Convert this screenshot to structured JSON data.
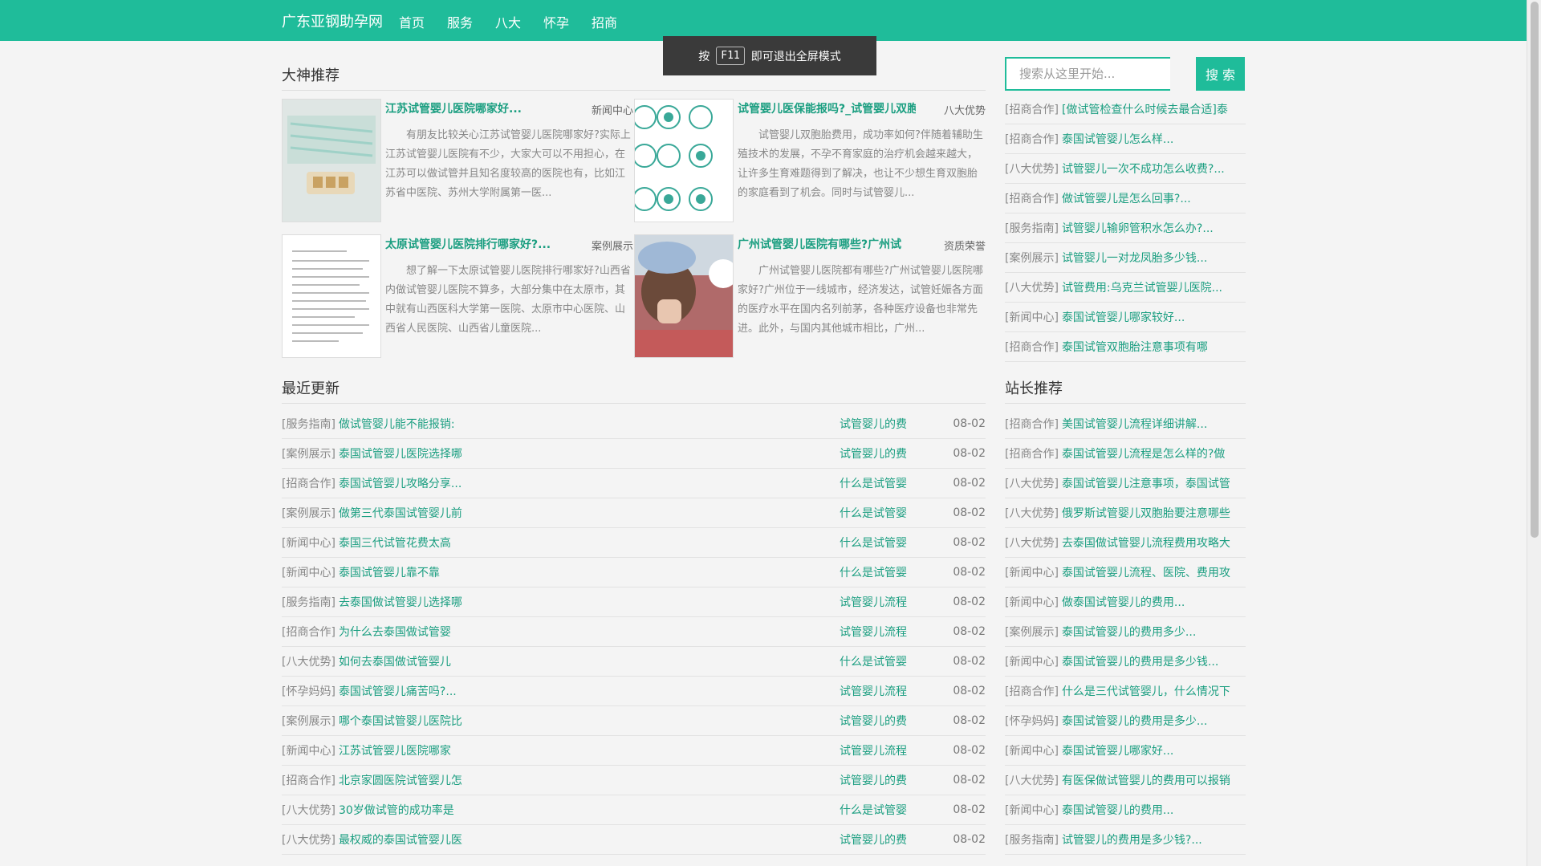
{
  "nav": {
    "brand": "广东亚钢助孕网",
    "items": [
      "首页",
      "服务",
      "八大",
      "怀孕",
      "招商"
    ]
  },
  "toast": {
    "before": "按",
    "key": "F11",
    "after": "即可退出全屏模式"
  },
  "search": {
    "placeholder": "搜索从这里开始...",
    "button": "搜 索"
  },
  "sections": {
    "featured": "大神推荐",
    "latest": "最近更新",
    "recommend": "站长推荐"
  },
  "featured": [
    {
      "title": "江苏试管婴儿医院哪家好...",
      "category": "新闻中心",
      "body": "有朋友比较关心江苏试管婴儿医院哪家好?实际上江苏试管婴儿医院有不少，大家大可以不用担心，在江苏可以做试管并且知名度较高的医院也有，比如江苏省中医院、苏州大学附属第一医..."
    },
    {
      "title": "试管婴儿医保能报吗?_试管婴儿双胞",
      "category": "八大优势",
      "body": "试管婴儿双胞胎费用，成功率如何?伴随着辅助生殖技术的发展，不孕不育家庭的治疗机会越来越大，让许多生育难题得到了解决，也让不少想生育双胞胎的家庭看到了机会。同时与试管婴儿..."
    },
    {
      "title": "太原试管婴儿医院排行哪家好?...",
      "category": "案例展示",
      "body": "想了解一下太原试管婴儿医院排行哪家好?山西省内做试管婴儿医院不算多，大部分集中在太原市，其中就有山西医科大学第一医院、太原市中心医院、山西省人民医院、山西省儿童医院..."
    },
    {
      "title": "广州试管婴儿医院有哪些?广州试",
      "category": "资质荣誉",
      "body": "广州试管婴儿医院都有哪些?广州试管婴儿医院哪家好?广州位于一线城市，经济发达，试管妊娠各方面的医疗水平在国内名列前茅，各种医疗设备也非常先进。此外，与国内其他城市相比，广州..."
    }
  ],
  "latest": [
    {
      "category": "[服务指南]",
      "title": "做试管婴儿能不能报销:",
      "tag": "试管婴儿的费",
      "date": "08-02"
    },
    {
      "category": "[案例展示]",
      "title": "泰国试管婴儿医院选择哪",
      "tag": "试管婴儿的费",
      "date": "08-02"
    },
    {
      "category": "[招商合作]",
      "title": "泰国试管婴儿攻略分享...",
      "tag": "什么是试管婴",
      "date": "08-02"
    },
    {
      "category": "[案例展示]",
      "title": "做第三代泰国试管婴儿前",
      "tag": "什么是试管婴",
      "date": "08-02"
    },
    {
      "category": "[新闻中心]",
      "title": "泰国三代试管花费太高",
      "tag": "什么是试管婴",
      "date": "08-02"
    },
    {
      "category": "[新闻中心]",
      "title": "泰国试管婴儿靠不靠",
      "tag": "什么是试管婴",
      "date": "08-02"
    },
    {
      "category": "[服务指南]",
      "title": "去泰国做试管婴儿选择哪",
      "tag": "试管婴儿流程",
      "date": "08-02"
    },
    {
      "category": "[招商合作]",
      "title": "为什么去泰国做试管婴",
      "tag": "试管婴儿流程",
      "date": "08-02"
    },
    {
      "category": "[八大优势]",
      "title": "如何去泰国做试管婴儿",
      "tag": "什么是试管婴",
      "date": "08-02"
    },
    {
      "category": "[怀孕妈妈]",
      "title": "泰国试管婴儿痛苦吗?...",
      "tag": "试管婴儿流程",
      "date": "08-02"
    },
    {
      "category": "[案例展示]",
      "title": "哪个泰国试管婴儿医院比",
      "tag": "试管婴儿的费",
      "date": "08-02"
    },
    {
      "category": "[新闻中心]",
      "title": "江苏试管婴儿医院哪家",
      "tag": "试管婴儿流程",
      "date": "08-02"
    },
    {
      "category": "[招商合作]",
      "title": "北京家圆医院试管婴儿怎",
      "tag": "试管婴儿的费",
      "date": "08-02"
    },
    {
      "category": "[八大优势]",
      "title": "30岁做试管的成功率是",
      "tag": "什么是试管婴",
      "date": "08-02"
    },
    {
      "category": "[八大优势]",
      "title": "最权威的泰国试管婴儿医",
      "tag": "试管婴儿的费",
      "date": "08-02"
    }
  ],
  "sidebar_top": [
    {
      "category": "[招商合作]",
      "title": "[做试管检查什么时候去最合适]泰"
    },
    {
      "category": "[招商合作]",
      "title": "泰国试管婴儿怎么样..."
    },
    {
      "category": "[八大优势]",
      "title": "试管婴儿一次不成功怎么收费?..."
    },
    {
      "category": "[招商合作]",
      "title": "做试管婴儿是怎么回事?..."
    },
    {
      "category": "[服务指南]",
      "title": "试管婴儿输卵管积水怎么办?..."
    },
    {
      "category": "[案例展示]",
      "title": "试管婴儿一对龙凤胎多少钱..."
    },
    {
      "category": "[八大优势]",
      "title": "试管费用:乌克兰试管婴儿医院..."
    },
    {
      "category": "[新闻中心]",
      "title": "泰国试管婴儿哪家较好..."
    },
    {
      "category": "[招商合作]",
      "title": "泰国试管双胞胎注意事项有哪"
    }
  ],
  "sidebar_recommend": [
    {
      "category": "[招商合作]",
      "title": "美国试管婴儿流程详细讲解..."
    },
    {
      "category": "[招商合作]",
      "title": "泰国试管婴儿流程是怎么样的?做"
    },
    {
      "category": "[八大优势]",
      "title": "泰国试管婴儿注意事项，泰国试管"
    },
    {
      "category": "[八大优势]",
      "title": "俄罗斯试管婴儿双胞胎要注意哪些"
    },
    {
      "category": "[八大优势]",
      "title": "去泰国做试管婴儿流程费用攻略大"
    },
    {
      "category": "[新闻中心]",
      "title": "泰国试管婴儿流程、医院、费用攻"
    },
    {
      "category": "[新闻中心]",
      "title": "做泰国试管婴儿的费用..."
    },
    {
      "category": "[案例展示]",
      "title": "泰国试管婴儿的费用多少..."
    },
    {
      "category": "[新闻中心]",
      "title": "泰国试管婴儿的费用是多少钱..."
    },
    {
      "category": "[招商合作]",
      "title": "什么是三代试管婴儿，什么情况下"
    },
    {
      "category": "[怀孕妈妈]",
      "title": "泰国试管婴儿的费用是多少..."
    },
    {
      "category": "[新闻中心]",
      "title": "泰国试管婴儿哪家好..."
    },
    {
      "category": "[八大优势]",
      "title": "有医保做试管婴儿的费用可以报销"
    },
    {
      "category": "[新闻中心]",
      "title": "泰国试管婴儿的费用..."
    },
    {
      "category": "[服务指南]",
      "title": "试管婴儿的费用是多少钱?..."
    }
  ],
  "colors": {
    "brand": "#1fbc9a",
    "link": "#1a9e80"
  }
}
